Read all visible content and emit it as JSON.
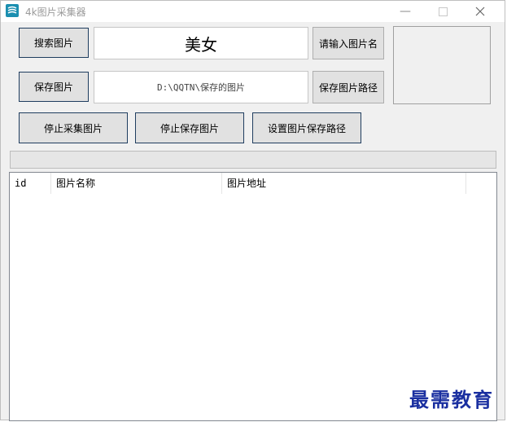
{
  "window": {
    "title": "4k图片采集器",
    "minimize_icon": "minimize-icon",
    "maximize_icon": "maximize-icon",
    "close_icon": "close-icon"
  },
  "toolbar": {
    "search_button": "搜索图片",
    "search_value": "美女",
    "enter_name_button": "请输入图片名",
    "save_button": "保存图片",
    "save_path_value": "D:\\QQTN\\保存的图片",
    "save_path_button": "保存图片路径",
    "stop_collect_button": "停止采集图片",
    "stop_save_button": "停止保存图片",
    "set_path_button": "设置图片保存路径"
  },
  "progress": {
    "percent": 0,
    "color": "#06b025"
  },
  "table": {
    "columns": [
      "id",
      "图片名称",
      "图片地址"
    ],
    "rows": []
  },
  "watermark": "最需教育",
  "colors": {
    "button_border": "#1f3d5f",
    "watermark": "#1a2fa0"
  }
}
